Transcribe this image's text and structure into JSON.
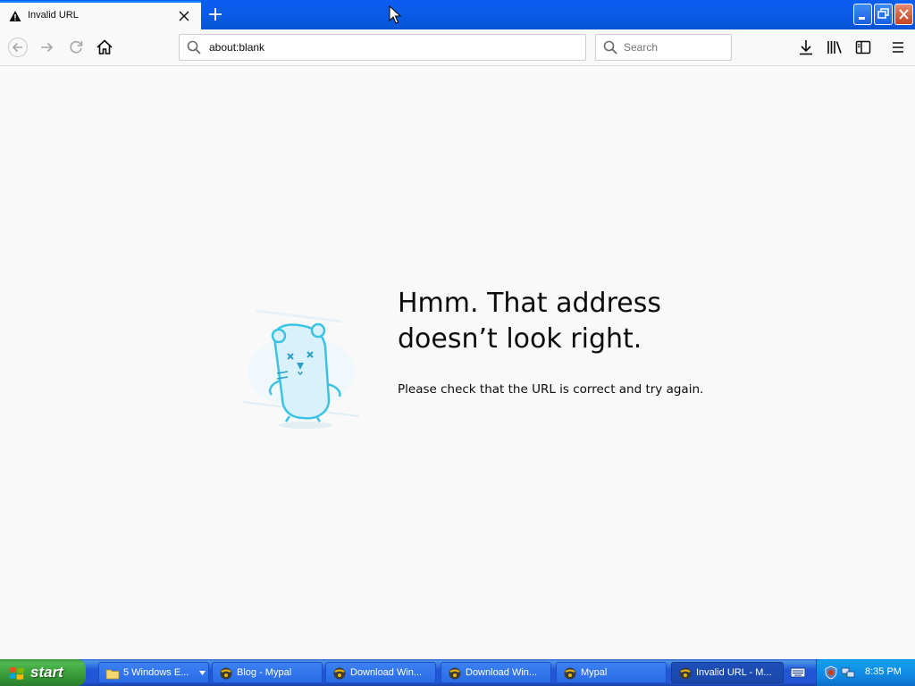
{
  "browser": {
    "tab": {
      "title": "Invalid URL",
      "icon": "warning-icon"
    },
    "url": "about:blank",
    "search_placeholder": "Search"
  },
  "error_page": {
    "title_line1": "Hmm. That address",
    "title_line2": "doesn’t look right.",
    "description": "Please check that the URL is correct and try again."
  },
  "taskbar": {
    "start_label": "start",
    "items": [
      {
        "label": "5 Windows E...",
        "icon": "folder-icon"
      },
      {
        "label": "Blog - Mypal",
        "icon": "mypal-icon"
      },
      {
        "label": "Download Win...",
        "icon": "mypal-icon"
      },
      {
        "label": "Download Win...",
        "icon": "mypal-icon"
      },
      {
        "label": "Mypal",
        "icon": "mypal-icon"
      },
      {
        "label": "Invalid URL - M...",
        "icon": "mypal-icon",
        "active": true
      }
    ],
    "clock": "8:35 PM"
  },
  "colors": {
    "titlebar_blue": "#0a5be8",
    "page_bg": "#f9f9fa",
    "start_green": "#3c9a3c",
    "tray_blue": "#0f89e3"
  }
}
